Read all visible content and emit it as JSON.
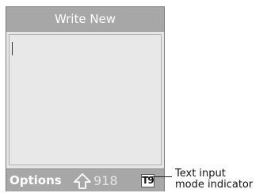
{
  "screen": {
    "title": "Write New",
    "softkey_left": "Options",
    "char_count": "918",
    "mode_indicator_glyph": "T9",
    "shift_icon": "shift-arrow-up-icon"
  },
  "callout": {
    "line1": "Text input",
    "line2": "mode indicator"
  },
  "colors": {
    "bar": "#a7a7a7",
    "body": "#e6e6e6"
  }
}
